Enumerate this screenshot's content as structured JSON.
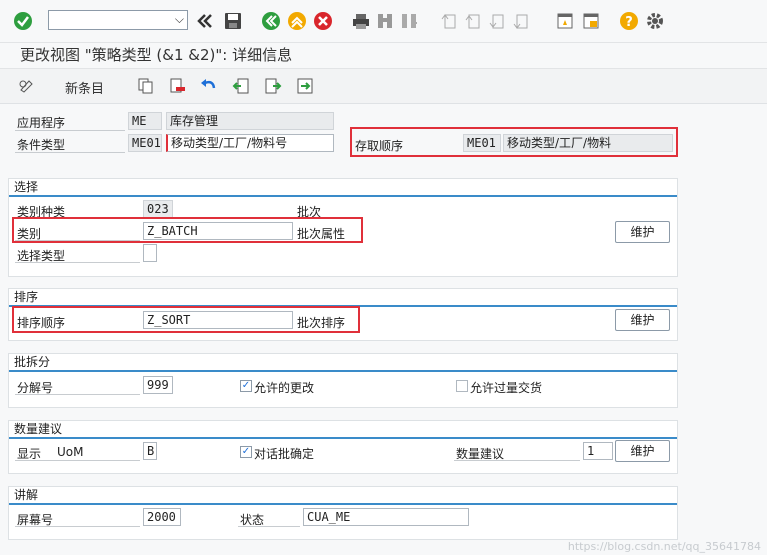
{
  "toolbar": {
    "icons": [
      "check-icon",
      "command-field",
      "back-double-icon",
      "save-icon",
      "back-icon",
      "exit-icon",
      "cancel-icon",
      "print-icon",
      "find-icon",
      "find-next-icon",
      "first-page-icon",
      "prev-page-icon",
      "next-page-icon",
      "last-page-icon",
      "create-session-icon",
      "shortcut-icon",
      "help-icon",
      "settings-icon"
    ]
  },
  "title": "更改视图 \"策略类型 (&1 &2)\": 详细信息",
  "app_toolbar": {
    "new_entries": "新条目"
  },
  "header": {
    "app_label": "应用程序",
    "app_code": "ME",
    "app_desc": "库存管理",
    "cond_label": "条件类型",
    "cond_code": "ME01",
    "cond_desc": "移动类型/工厂/物料号",
    "access_label": "存取顺序",
    "access_code": "ME01",
    "access_desc": "移动类型/工厂/物料"
  },
  "selection": {
    "title": "选择",
    "class_type_label": "类别种类",
    "class_type": "023",
    "class_type_desc": "批次",
    "class_label": "类别",
    "class_value": "Z_BATCH",
    "class_desc": "批次属性",
    "sel_type_label": "选择类型",
    "sel_type": "",
    "maintain": "维护"
  },
  "sort": {
    "title": "排序",
    "label": "排序顺序",
    "value": "Z_SORT",
    "desc": "批次排序",
    "maintain": "维护"
  },
  "split": {
    "title": "批拆分",
    "label": "分解号",
    "value": "999",
    "allow_change": "允许的更改",
    "allow_change_checked": true,
    "allow_over": "允许过量交货",
    "allow_over_checked": false
  },
  "qty": {
    "title": "数量建议",
    "display_label": "显示",
    "uom_label": "UoM",
    "uom_value": "B",
    "dialog_confirm": "对话批确定",
    "dialog_checked": true,
    "proposal_label": "数量建议",
    "proposal_value": "1",
    "maintain": "维护"
  },
  "explain": {
    "title": "讲解",
    "screen_label": "屏幕号",
    "screen_value": "2000",
    "status_label": "状态",
    "status_value": "CUA_ME"
  },
  "watermark": "https://blog.csdn.net/qq_35641784"
}
